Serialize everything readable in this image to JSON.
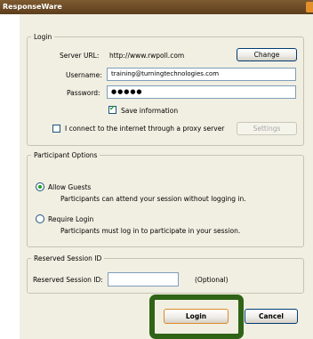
{
  "window": {
    "title": "ResponseWare",
    "close_icon": "close-icon"
  },
  "login": {
    "group_label": "Login",
    "server_url_label": "Server URL:",
    "server_url_value": "http://www.rwpoll.com",
    "change_button": "Change",
    "username_label": "Username:",
    "username_value": "training@turningtechnologies.com",
    "password_label": "Password:",
    "password_value": "●●●●●",
    "save_info_label": "Save information",
    "save_info_checked": true,
    "proxy_label": "I connect to the internet through a proxy server",
    "proxy_checked": false,
    "settings_button": "Settings"
  },
  "participant_options": {
    "group_label": "Participant Options",
    "allow_guests_label": "Allow Guests",
    "allow_guests_desc": "Participants can attend your session without logging in.",
    "allow_guests_selected": true,
    "require_login_label": "Require Login",
    "require_login_desc": "Participants must log in to participate in your session.",
    "require_login_selected": false
  },
  "reserved_session": {
    "group_label": "Reserved Session ID",
    "field_label": "Reserved Session ID:",
    "field_value": "",
    "optional_label": "(Optional)"
  },
  "actions": {
    "login_button": "Login",
    "cancel_button": "Cancel",
    "highlight_color": "#2f6416"
  }
}
